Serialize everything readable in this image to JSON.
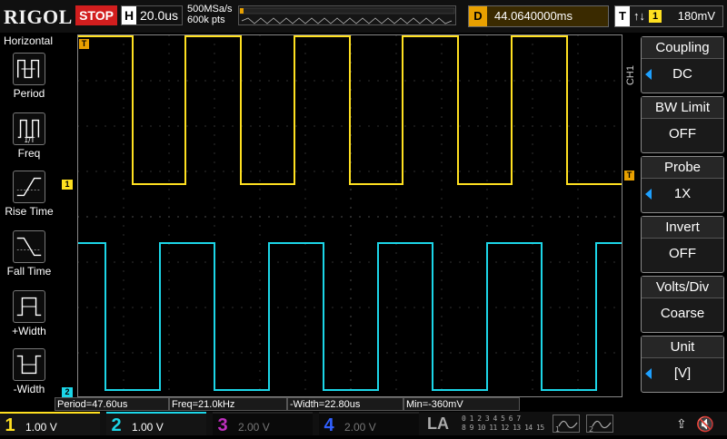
{
  "top": {
    "logo": "RIGOL",
    "run_state": "STOP",
    "horizontal_label": "H",
    "timebase": "20.0us",
    "sample_rate": "500MSa/s",
    "memory_depth": "600k pts",
    "delay_label": "D",
    "delay_value": "44.0640000ms",
    "trigger_label": "T",
    "trigger_edge_icon": "rise-fall-edge-icon",
    "trigger_source": "1",
    "trigger_level": "180mV"
  },
  "left_menu": {
    "title": "Horizontal",
    "items": [
      {
        "label": "Period",
        "icon": "period-icon"
      },
      {
        "label": "Freq",
        "icon": "freq-icon"
      },
      {
        "label": "Rise Time",
        "icon": "rise-time-icon"
      },
      {
        "label": "Fall Time",
        "icon": "fall-time-icon"
      },
      {
        "label": "+Width",
        "icon": "pos-width-icon"
      },
      {
        "label": "-Width",
        "icon": "neg-width-icon"
      }
    ]
  },
  "right_menu": {
    "channel": "CH1",
    "buttons": [
      {
        "title": "Coupling",
        "value": "DC",
        "adjustable": true
      },
      {
        "title": "BW Limit",
        "value": "OFF",
        "adjustable": false
      },
      {
        "title": "Probe",
        "value": "1X",
        "adjustable": true
      },
      {
        "title": "Invert",
        "value": "OFF",
        "adjustable": false
      },
      {
        "title": "Volts/Div",
        "value": "Coarse",
        "adjustable": false
      },
      {
        "title": "Unit",
        "value": "[V]",
        "adjustable": true
      }
    ]
  },
  "measurements": {
    "period": "Period=47.60us",
    "freq": "Freq=21.0kHz",
    "neg_width": "-Width=22.80us",
    "min": "Min=-360mV"
  },
  "markers": {
    "ch1": "1",
    "ch2": "2",
    "trigger": "T"
  },
  "channels": [
    {
      "num": "1",
      "scale": "1.00 V",
      "color": "#ffe020"
    },
    {
      "num": "2",
      "scale": "1.00 V",
      "color": "#1cd6e8"
    },
    {
      "num": "3",
      "scale": "2.00 V",
      "color": "#c030c0"
    },
    {
      "num": "4",
      "scale": "2.00 V",
      "color": "#3060ff"
    }
  ],
  "bottom": {
    "la_label": "LA",
    "digital_row1": "0 1 2 3  4 5 6 7",
    "digital_row2": "8 9 10 11 12 13 14 15",
    "gen1": "1",
    "gen2": "2"
  },
  "colors": {
    "ch1": "#ffe020",
    "ch2": "#1cd6e8",
    "stop": "#d21e1e",
    "delay": "#e8a000",
    "menu_arrow": "#1da0ff"
  },
  "chart_data": {
    "type": "line",
    "xlabel": "",
    "ylabel": "",
    "grid": true,
    "series": [
      {
        "color": "#ffe020",
        "high": true,
        "values_note": ""
      },
      {
        "color": "#1cd6e8",
        "high": true,
        "values_note": ""
      }
    ]
  }
}
